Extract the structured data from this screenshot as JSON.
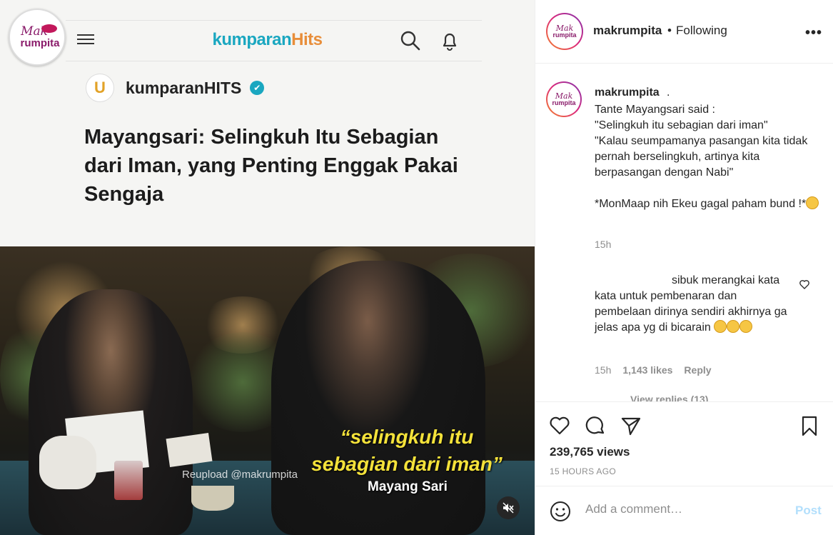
{
  "media": {
    "logo": {
      "line1": "Mak",
      "line2": "rumpita"
    },
    "brand": {
      "part1": "kumparan",
      "part2": "Hits"
    },
    "account": {
      "initial": "U",
      "name": "kumparanHITS",
      "verified_mark": "✔"
    },
    "headline": "Mayangsari: Selingkuh Itu Sebagian dari Iman, yang Penting Enggak Pakai Sengaja",
    "video": {
      "quote": "“selingkuh itu sebagian dari iman”",
      "speaker": "Mayang Sari",
      "watermark": "Reupload @makrumpita"
    }
  },
  "header": {
    "username": "makrumpita",
    "dot": "•",
    "follow_state": "Following",
    "more": "•••"
  },
  "caption": {
    "username": "makrumpita",
    "suffix": ".",
    "text": "Tante Mayangsari said :\n\"Selingkuh itu sebagian dari iman\"\n\"Kalau seumpamanya pasangan kita tidak pernah berselingkuh, artinya kita berpasangan dengan Nabi\"\n\n*MonMaap nih Ekeu gagal paham bund !*",
    "time": "15h"
  },
  "reply": {
    "text_line1": "sibuk merangkai",
    "text_rest": "kata kata untuk pembenaran dan pembelaan dirinya sendiri akhirnya ga jelas apa yg di bicarain",
    "time": "15h",
    "likes": "1,143 likes",
    "reply_label": "Reply",
    "view_replies": "View replies (13)"
  },
  "stats": {
    "views": "239,765 views",
    "ago": "15 HOURS AGO"
  },
  "add_comment": {
    "placeholder": "Add a comment…",
    "post_label": "Post"
  },
  "colors": {
    "kumparan_blue": "#1aa7c0",
    "kumparan_orange": "#e88e3a",
    "quote_yellow": "#f4e23a",
    "post_disabled": "#b2dffc"
  },
  "icons": [
    "hamburger-icon",
    "search-icon",
    "bell-icon",
    "verified-icon",
    "more-icon",
    "heart-icon",
    "comment-icon",
    "share-icon",
    "bookmark-icon",
    "smile-icon",
    "muted-icon"
  ]
}
